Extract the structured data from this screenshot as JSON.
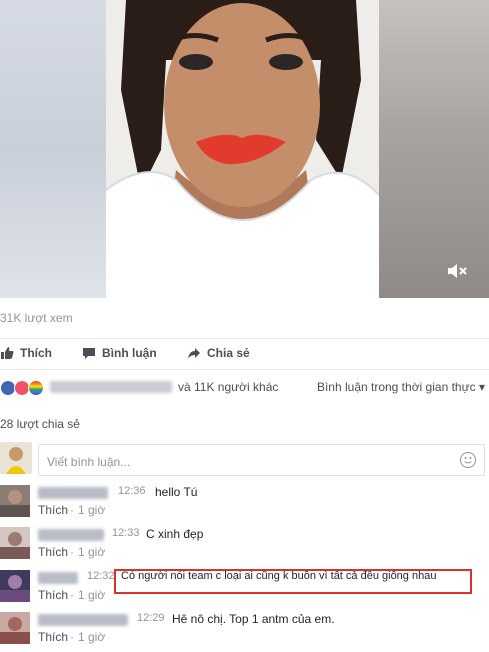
{
  "video": {
    "mute_icon": "volume-mute-icon"
  },
  "stats": {
    "views": "31K lượt xem"
  },
  "actions": {
    "like_label": "Thích",
    "comment_label": "Bình luận",
    "share_label": "Chia sẻ"
  },
  "reactions": {
    "others_text": "và 11K người khác",
    "realtime_label": "Bình luận trong thời gian thực",
    "colors": [
      "#4267b2",
      "#f25268",
      "#f7b125"
    ]
  },
  "shares": {
    "text": "28 lượt chia sẻ"
  },
  "comment_input": {
    "placeholder": "Viết bình luận..."
  },
  "comments": [
    {
      "time": "12:36",
      "text": "hello Tú",
      "like": "Thích",
      "ago": "1 giờ"
    },
    {
      "time": "12:33",
      "text": "C xinh đẹp",
      "like": "Thích",
      "ago": "1 giờ"
    },
    {
      "time": "12:32",
      "text": "Có người nói team c loại ai cũng k buồn vì tất cả đều giống nhau",
      "like": "Thích",
      "ago": "1 giờ"
    },
    {
      "time": "12:29",
      "text": "Hê nô chị. Top 1 antm của em.",
      "like": "Thích",
      "ago": "1 giờ"
    }
  ],
  "separator": "·"
}
